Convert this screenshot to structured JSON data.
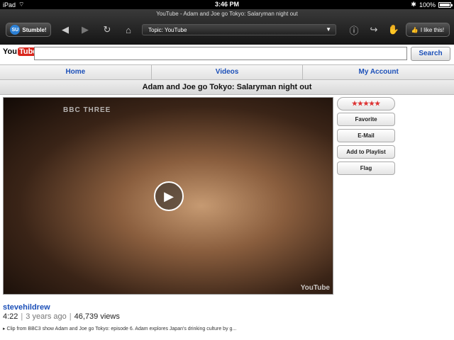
{
  "status_bar": {
    "device": "iPad",
    "time": "3:46 PM",
    "battery": "100%"
  },
  "toolbar": {
    "page_title": "YouTube - Adam and Joe go Tokyo: Salaryman night out",
    "stumble_label": "Stumble!",
    "topic_label": "Topic: YouTube",
    "like_label": "I like this!"
  },
  "header": {
    "logo_you": "You",
    "logo_tube": "Tube",
    "search_button": "Search"
  },
  "nav": {
    "tabs": [
      "Home",
      "Videos",
      "My Account"
    ]
  },
  "video": {
    "title": "Adam and Joe go Tokyo: Salaryman night out",
    "channel_bug": "BBC THREE",
    "watermark": "YouTube",
    "uploader": "stevehildrew",
    "duration": "4:22",
    "age": "3 years ago",
    "views": "46,739 views",
    "description": "Clip from BBC3 show Adam and Joe go Tokyo: episode 6. Adam explores Japan's drinking culture by g..."
  },
  "actions": {
    "rating": "★★★★★",
    "favorite": "Favorite",
    "email": "E-Mail",
    "add_playlist": "Add to Playlist",
    "flag": "Flag"
  },
  "colors": {
    "link_blue": "#1b4fb8",
    "youtube_red": "#d9261c"
  }
}
